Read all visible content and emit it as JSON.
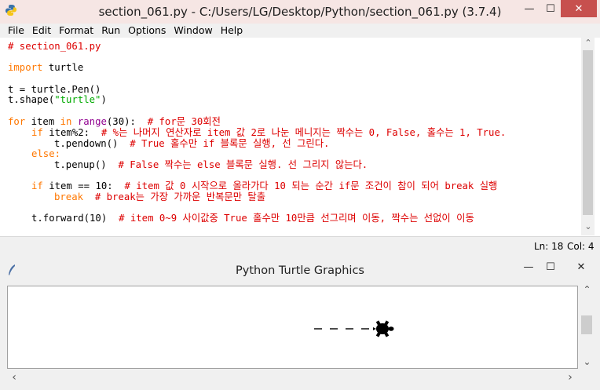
{
  "idle_window": {
    "title": "section_061.py - C:/Users/LG/Desktop/Python/section_061.py (3.7.4)",
    "minimize_glyph": "—",
    "maximize_glyph": "☐",
    "close_glyph": "✕",
    "menu": [
      "File",
      "Edit",
      "Format",
      "Run",
      "Options",
      "Window",
      "Help"
    ],
    "code": {
      "l1_comment": "# section_061.py",
      "l2_kw": "import",
      "l2_rest": " turtle",
      "l3": "t = turtle.Pen()",
      "l4_a": "t.shape(",
      "l4_str": "\"turtle\"",
      "l4_b": ")",
      "l5_kw1": "for",
      "l5_a": " item ",
      "l5_kw2": "in",
      "l5_sp": " ",
      "l5_bi": "range",
      "l5_b": "(30):  ",
      "l5_cm": "# for문 30회전",
      "l6_kw": "if",
      "l6_a": " item%2:  ",
      "l6_cm": "# %는 나머지 연산자로 item 값 2로 나눈 메니지는 짝수는 0, False, 홀수는 1, True.",
      "l7_a": "t.pendown()  ",
      "l7_cm": "# True 홀수만 if 블록문 실행, 선 그린다.",
      "l8_kw": "else",
      "l8_a": ":",
      "l9_a": "t.penup()  ",
      "l9_cm": "# False 짝수는 else 블록문 실행. 선 그리지 않는다.",
      "l10_kw": "if",
      "l10_a": " item == 10:  ",
      "l10_cm": "# item 값 0 시작으로 올라가다 10 되는 순간 if문 조건이 참이 되어 break 실행",
      "l11_kw": "break",
      "l11_sp": "  ",
      "l11_cm": "# break는 가장 가까운 반복문만 탈출",
      "l12_a": "t.forward(10)  ",
      "l12_cm": "# item 0~9 사이값중 True 홀수만 10만큼 선그리며 이동, 짝수는 선없이 이동"
    },
    "status": {
      "line": "Ln: 18",
      "col": "Col: 4"
    }
  },
  "turtle_window": {
    "title": "Python Turtle Graphics",
    "minimize_glyph": "—",
    "maximize_glyph": "☐",
    "close_glyph": "✕",
    "scroll_up": "⌃",
    "scroll_down": "⌄",
    "scroll_left": "‹",
    "scroll_right": "›",
    "pen_segments": 4
  }
}
